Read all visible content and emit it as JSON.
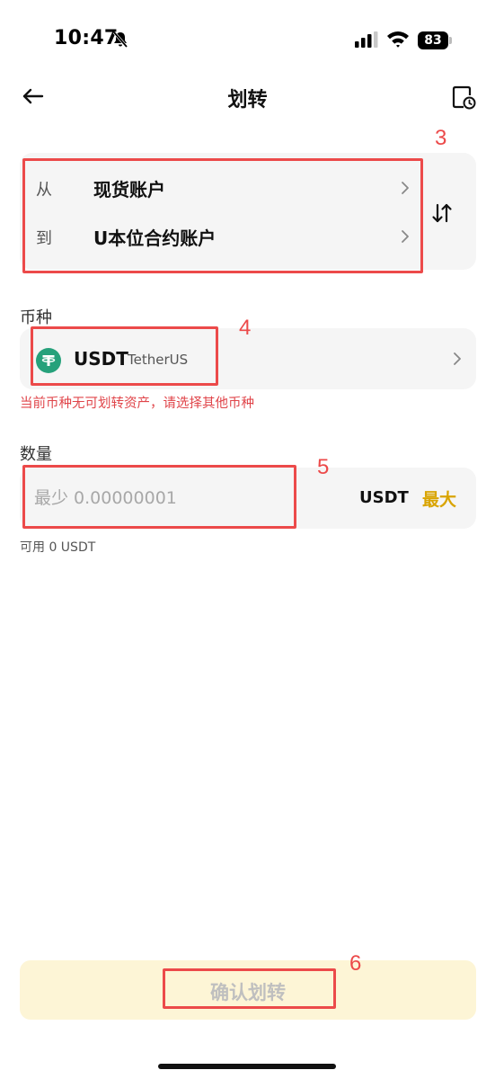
{
  "status_bar": {
    "time": "10:47",
    "battery": "83"
  },
  "header": {
    "title": "划转"
  },
  "transfer": {
    "from_label": "从",
    "from_account": "现货账户",
    "to_label": "到",
    "to_account": "U本位合约账户"
  },
  "currency": {
    "section_label": "币种",
    "coin_symbol": "USDT",
    "coin_name": "TetherUS",
    "warning": "当前币种无可划转资产，请选择其他币种"
  },
  "amount": {
    "section_label": "数量",
    "placeholder": "最少 0.00000001",
    "unit": "USDT",
    "max_label": "最大",
    "available": "可用 0 USDT"
  },
  "confirm": {
    "label": "确认划转"
  },
  "annotations": {
    "n3": "3",
    "n4": "4",
    "n5": "5",
    "n6": "6"
  },
  "colors": {
    "accent": "#d9a400",
    "warning": "#e0454a",
    "annotation": "#ec4a4a",
    "card_bg": "#f5f5f5",
    "confirm_bg": "#fdf5d6",
    "tether": "#26a17b"
  }
}
